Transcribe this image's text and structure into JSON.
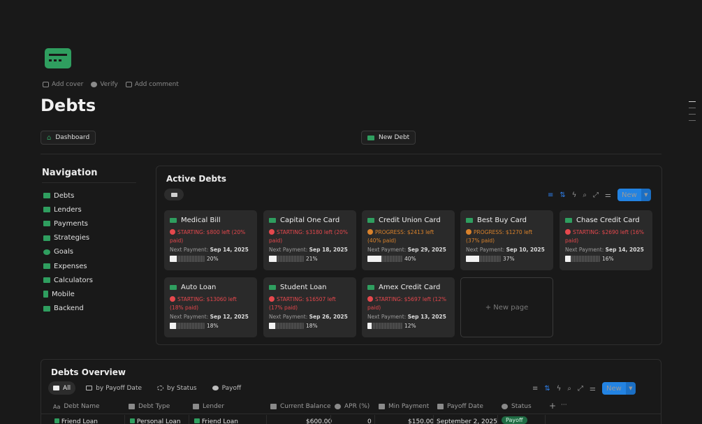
{
  "meta": {
    "add_cover": "Add cover",
    "verify": "Verify",
    "add_comment": "Add comment"
  },
  "page": {
    "title": "Debts",
    "icon": "credit-card-icon"
  },
  "buttons": {
    "dashboard": "Dashboard",
    "new_debt": "New Debt"
  },
  "navigation": {
    "title": "Navigation",
    "items": [
      {
        "label": "Debts",
        "icon": "credit-card-icon"
      },
      {
        "label": "Lenders",
        "icon": "bank-icon"
      },
      {
        "label": "Payments",
        "icon": "receipt-icon"
      },
      {
        "label": "Strategies",
        "icon": "map-icon"
      },
      {
        "label": "Goals",
        "icon": "target-icon"
      },
      {
        "label": "Expenses",
        "icon": "money-icon"
      },
      {
        "label": "Calculators",
        "icon": "calculator-icon"
      },
      {
        "label": "Mobile",
        "icon": "phone-icon"
      },
      {
        "label": "Backend",
        "icon": "database-icon"
      }
    ]
  },
  "active_debts": {
    "title": "Active Debts",
    "new_label": "New",
    "cards": [
      {
        "name": "Medical Bill",
        "icon": "medical-bag-icon",
        "status_text": "STARTING: $800 left (20% paid)",
        "status_color": "red",
        "next_label": "Next Payment:",
        "next_date": "Sep 14, 2025",
        "progress": 20,
        "progress_label": "20%"
      },
      {
        "name": "Capital One Card",
        "icon": "credit-card-icon",
        "status_text": "STARTING: $3180 left (20% paid)",
        "status_color": "red",
        "next_label": "Next Payment:",
        "next_date": "Sep 18, 2025",
        "progress": 21,
        "progress_label": "21%"
      },
      {
        "name": "Credit Union Card",
        "icon": "credit-card-icon",
        "status_text": "PROGRESS: $2413 left (40% paid)",
        "status_color": "orange",
        "next_label": "Next Payment:",
        "next_date": "Sep 29, 2025",
        "progress": 40,
        "progress_label": "40%"
      },
      {
        "name": "Best Buy Card",
        "icon": "credit-card-icon",
        "status_text": "PROGRESS: $1270 left (37% paid)",
        "status_color": "orange",
        "next_label": "Next Payment:",
        "next_date": "Sep 10, 2025",
        "progress": 37,
        "progress_label": "37%"
      },
      {
        "name": "Chase Credit Card",
        "icon": "credit-card-icon",
        "status_text": "STARTING: $2690 left (16% paid)",
        "status_color": "red",
        "next_label": "Next Payment:",
        "next_date": "Sep 14, 2025",
        "progress": 16,
        "progress_label": "16%"
      },
      {
        "name": "Auto Loan",
        "icon": "car-icon",
        "status_text": "STARTING: $13060 left (18% paid)",
        "status_color": "red",
        "next_label": "Next Payment:",
        "next_date": "Sep 12, 2025",
        "progress": 18,
        "progress_label": "18%"
      },
      {
        "name": "Student Loan",
        "icon": "school-icon",
        "status_text": "STARTING: $16507 left (17% paid)",
        "status_color": "red",
        "next_label": "Next Payment:",
        "next_date": "Sep 26, 2025",
        "progress": 18,
        "progress_label": "18%"
      },
      {
        "name": "Amex Credit Card",
        "icon": "credit-card-icon",
        "status_text": "STARTING: $5697 left (12% paid)",
        "status_color": "red",
        "next_label": "Next Payment:",
        "next_date": "Sep 13, 2025",
        "progress": 12,
        "progress_label": "12%"
      }
    ],
    "new_page": "+ New page"
  },
  "overview": {
    "title": "Debts Overview",
    "tabs": [
      "All",
      "by Payoff Date",
      "by Status",
      "Payoff"
    ],
    "new_label": "New",
    "columns": [
      "Debt Name",
      "Debt Type",
      "Lender",
      "Current Balance",
      "APR (%)",
      "Min Payment",
      "Payoff Date",
      "Status"
    ],
    "rows": [
      {
        "name": "Friend Loan",
        "type": "Personal Loan",
        "lender": "Friend Loan",
        "balance": "$600.00",
        "apr": "0",
        "min_payment": "$150.00",
        "payoff": "September 2, 2025",
        "status": "Payoff"
      }
    ]
  },
  "colors": {
    "accent": "#2383e2",
    "brand_green": "#2f9e5f",
    "red": "#e5484d",
    "orange": "#d9822b",
    "background": "#191919"
  }
}
